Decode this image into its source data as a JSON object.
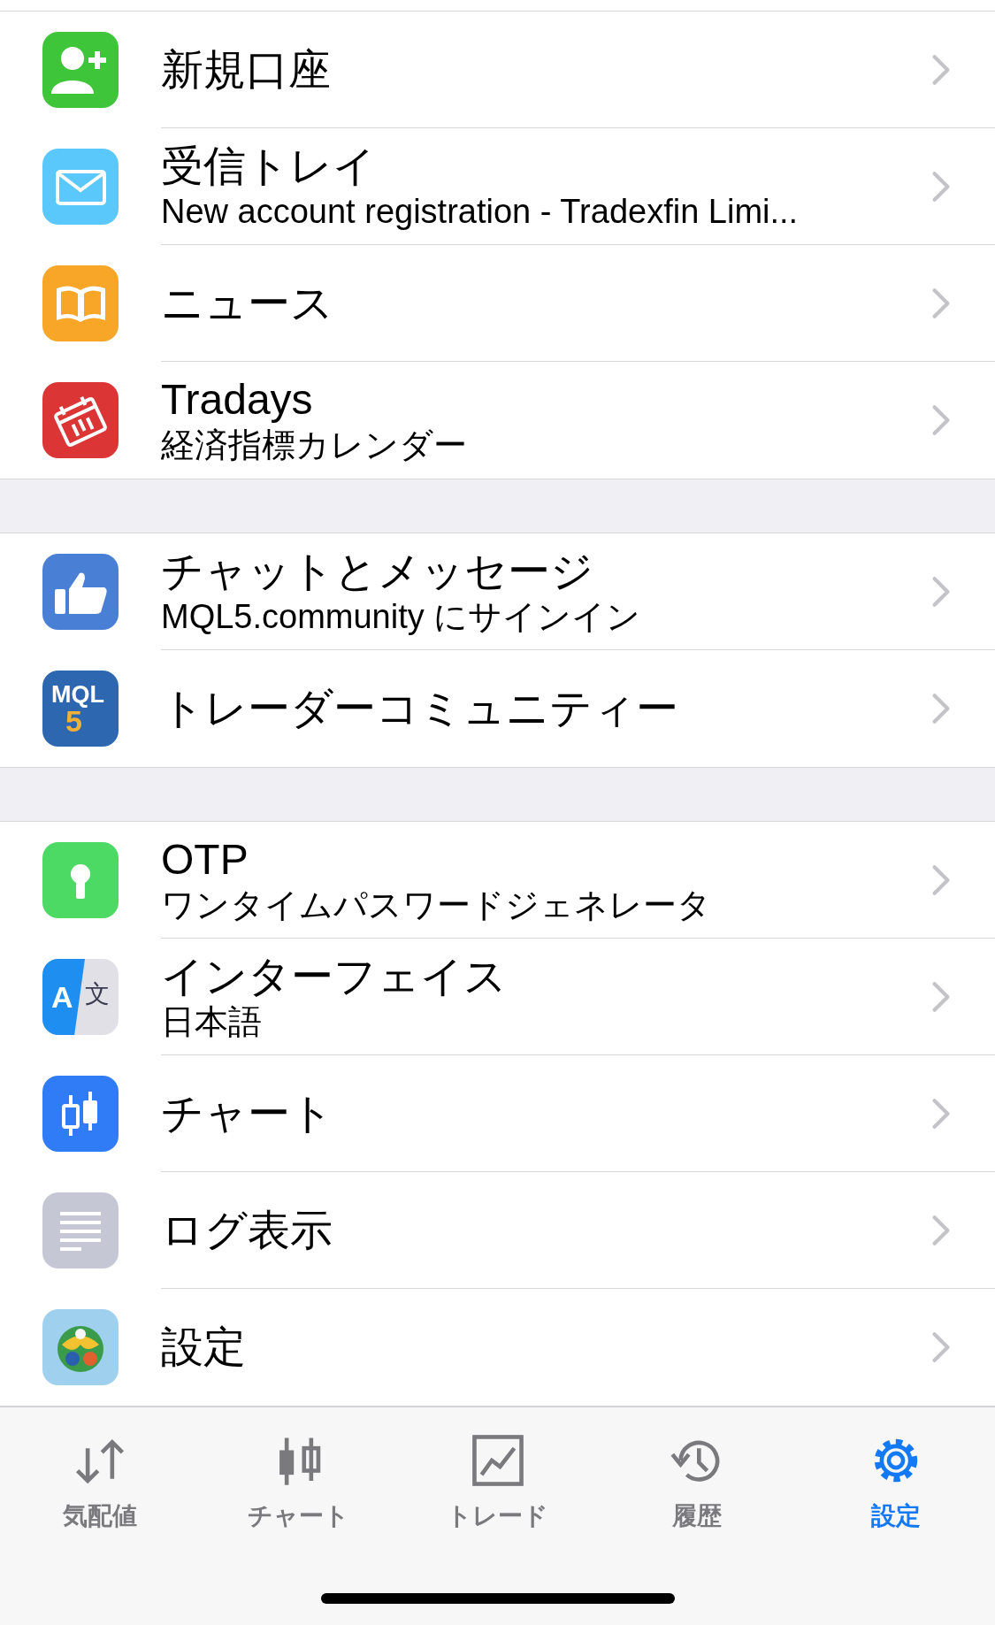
{
  "sections": [
    {
      "items": [
        {
          "title": "新規口座"
        },
        {
          "title": "受信トレイ",
          "subtitle": "New account registration - Tradexfin Limi..."
        },
        {
          "title": "ニュース"
        },
        {
          "title": "Tradays",
          "subtitle": "経済指標カレンダー"
        }
      ]
    },
    {
      "items": [
        {
          "title": "チャットとメッセージ",
          "subtitle": "MQL5.community にサインイン"
        },
        {
          "title": "トレーダーコミュニティー",
          "icon_text": [
            "MQL",
            "5"
          ]
        }
      ]
    },
    {
      "items": [
        {
          "title": "OTP",
          "subtitle": "ワンタイムパスワードジェネレータ"
        },
        {
          "title": "インターフェイス",
          "subtitle": "日本語",
          "icon_text": [
            "A",
            "文"
          ]
        },
        {
          "title": "チャート"
        },
        {
          "title": "ログ表示"
        },
        {
          "title": "設定"
        }
      ]
    }
  ],
  "tab_bar": [
    {
      "label": "気配値",
      "selected": false
    },
    {
      "label": "チャート",
      "selected": false
    },
    {
      "label": "トレード",
      "selected": false
    },
    {
      "label": "履歴",
      "selected": false
    },
    {
      "label": "設定",
      "selected": true
    }
  ]
}
